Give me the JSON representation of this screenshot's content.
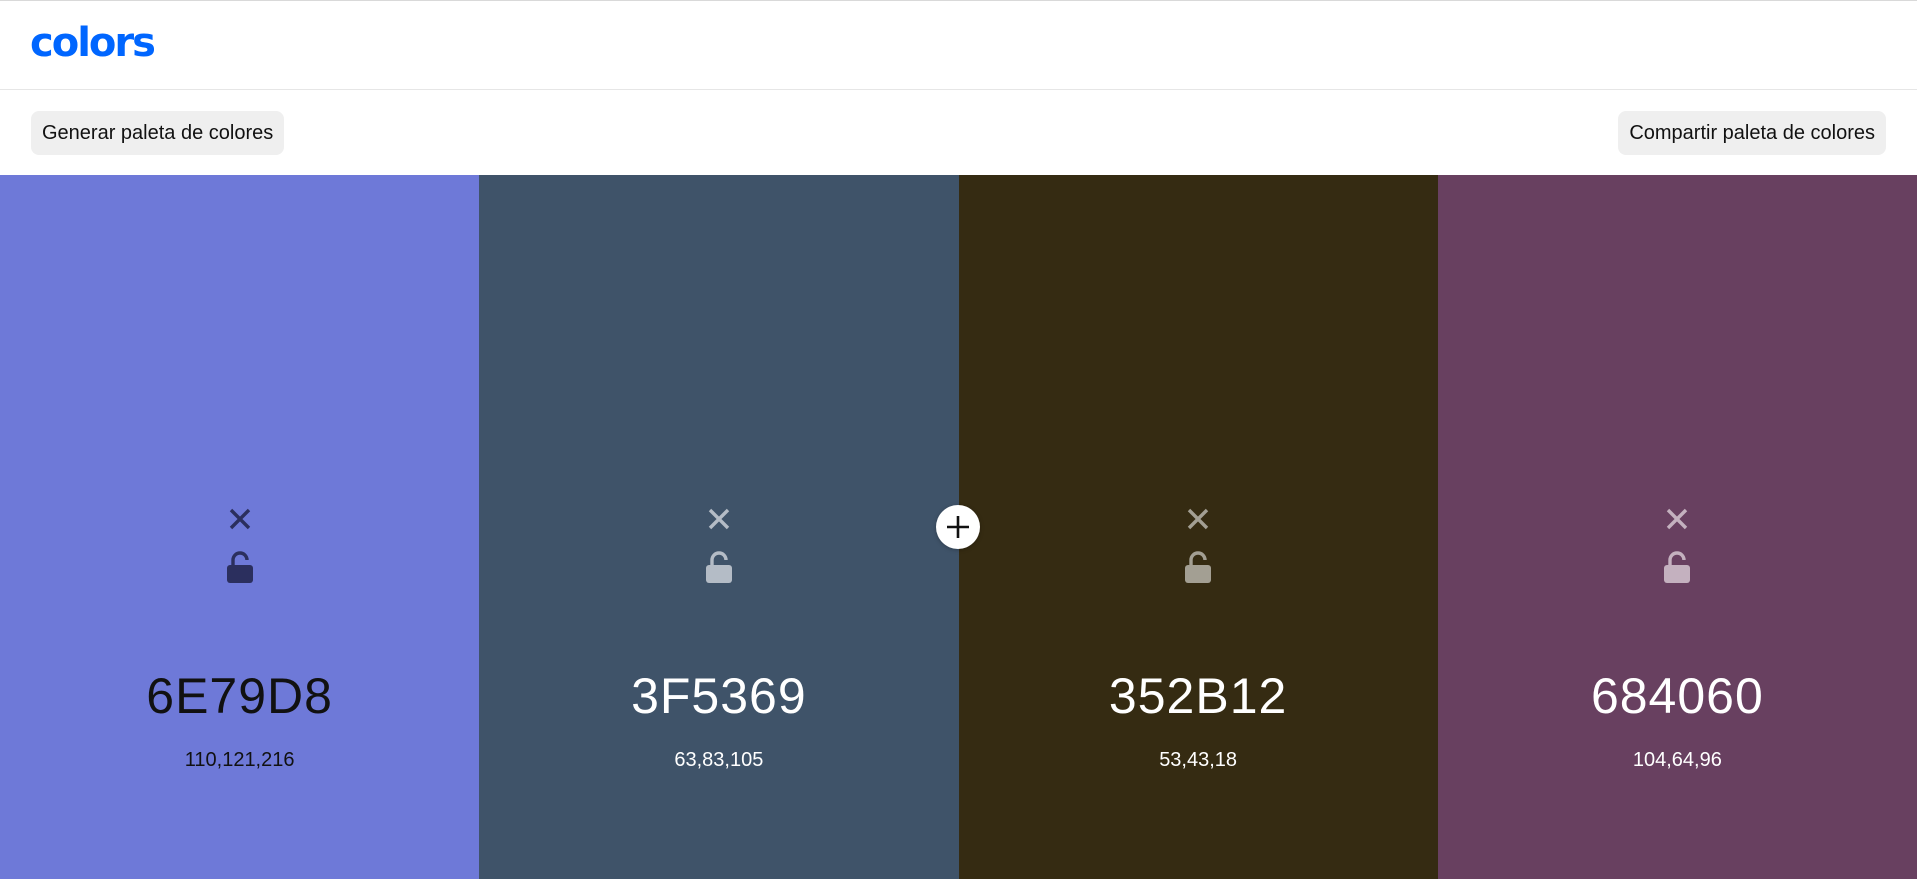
{
  "header": {
    "logo": "colors",
    "logo_color": "#0066ff"
  },
  "toolbar": {
    "generate_label": "Generar paleta de colores",
    "share_label": "Compartir paleta de colores"
  },
  "palette": {
    "colors": [
      {
        "hex": "6E79D8",
        "rgb": "110,121,216",
        "background": "#6E79D8",
        "text_color": "#111111",
        "icon_color": "#2b2f5e"
      },
      {
        "hex": "3F5369",
        "rgb": "63,83,105",
        "background": "#3F5369",
        "text_color": "#ffffff",
        "icon_color": "#b4bcc6"
      },
      {
        "hex": "352B12",
        "rgb": "53,43,18",
        "background": "#352B12",
        "text_color": "#ffffff",
        "icon_color": "#a39f93"
      },
      {
        "hex": "684060",
        "rgb": "104,64,96",
        "background": "#684060",
        "text_color": "#ffffff",
        "icon_color": "#c4b1bf"
      }
    ]
  },
  "icons": {
    "remove": "x-icon",
    "lock": "unlocked-lock-icon",
    "add": "plus-icon"
  }
}
